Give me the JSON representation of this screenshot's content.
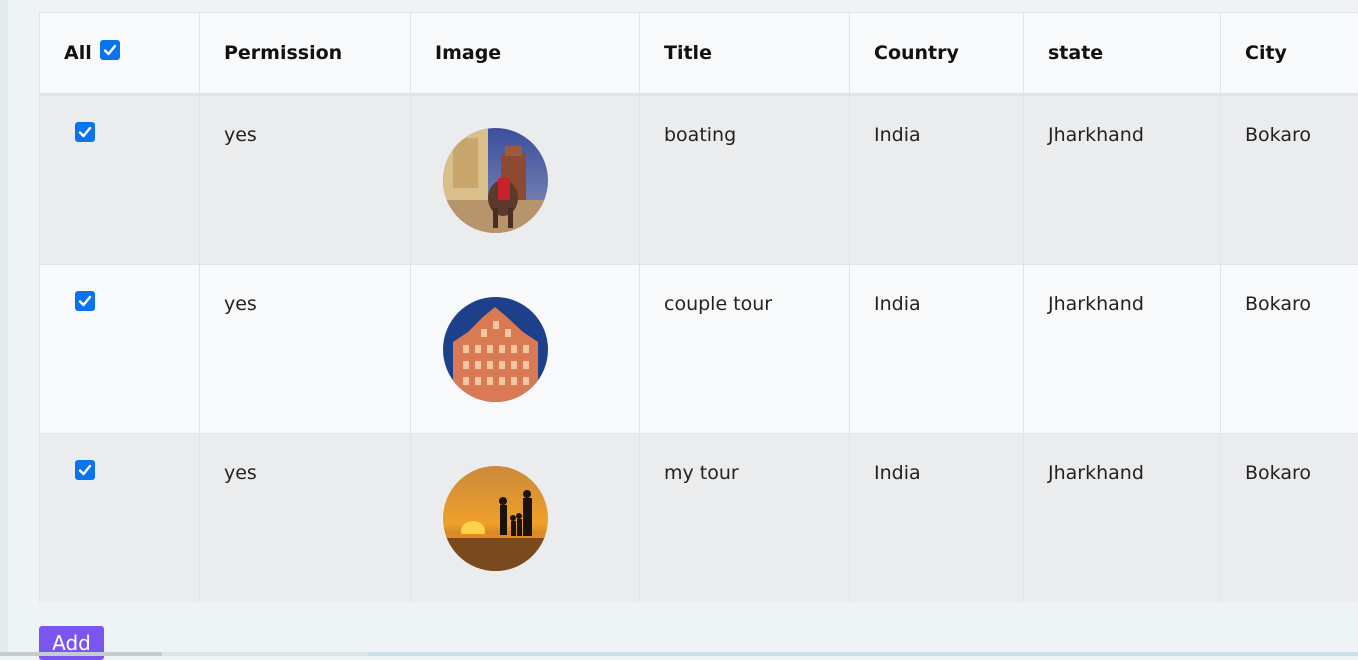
{
  "table": {
    "headers": {
      "all": "All",
      "permission": "Permission",
      "image": "Image",
      "title": "Title",
      "country": "Country",
      "state": "state",
      "city": "City"
    },
    "all_checked": true,
    "rows": [
      {
        "checked": true,
        "permission": "yes",
        "image": "amber-fort-elephant-photo",
        "title": "boating",
        "country": "India",
        "state": "Jharkhand",
        "city": "Bokaro"
      },
      {
        "checked": true,
        "permission": "yes",
        "image": "hawa-mahal-palace-photo",
        "title": "couple tour",
        "country": "India",
        "state": "Jharkhand",
        "city": "Bokaro"
      },
      {
        "checked": true,
        "permission": "yes",
        "image": "sunset-beach-family-photo",
        "title": "my tour",
        "country": "India",
        "state": "Jharkhand",
        "city": "Bokaro"
      }
    ]
  },
  "add_button": {
    "label": "Add"
  },
  "colors": {
    "checkbox": "#0a74ec",
    "add_button": "#7b55f0",
    "row_odd": "#ebecee",
    "row_even": "#f7f9fb"
  }
}
